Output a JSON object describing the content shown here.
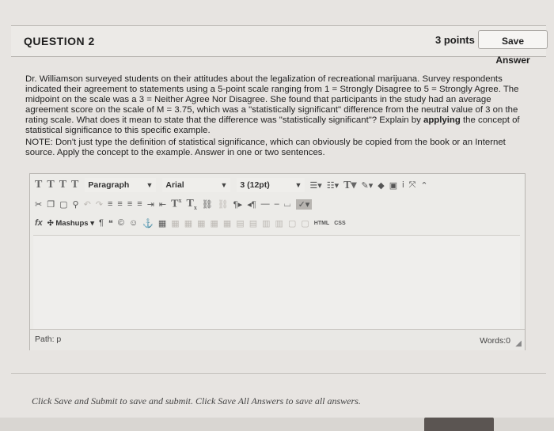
{
  "question": {
    "title": "QUESTION 2",
    "points": "3 points",
    "save_label": "Save Answer",
    "prompt": "Dr. Williamson surveyed students on their attitudes about the legalization of recreational marijuana. Survey respondents indicated their agreement to statements using a 5-point scale ranging from 1 = Strongly Disagree to 5 = Strongly Agree. The midpoint on the scale was a 3 = Neither Agree Nor Disagree. She found that participants in the study had an average agreement score on the scale of M = 3.75, which was a \"statistically significant\" difference from the neutral value of 3 on the rating scale. What does it mean to state that the difference was \"statistically significant\"? Explain by ",
    "prompt_bold": "applying",
    "prompt_end": " the concept of statistical significance to this specific example.",
    "note": "NOTE: Don't just type the definition of statistical significance, which can obviously be copied from the book or an Internet source. Apply the concept to the example. Answer in one or two sentences."
  },
  "toolbar": {
    "format_buttons": [
      "T",
      "T",
      "T",
      "T"
    ],
    "paragraph": "Paragraph",
    "font": "Arial",
    "size": "3 (12pt)",
    "superscript": "T",
    "subscript": "T",
    "mashups": "Mashups",
    "fx": "fx",
    "html_label": "HTML",
    "css_label": "CSS"
  },
  "editor": {
    "path_label": "Path: p",
    "words_label": "Words:0"
  },
  "footer": {
    "instructions": "Click Save and Submit to save and submit. Click Save All Answers to save all answers."
  }
}
